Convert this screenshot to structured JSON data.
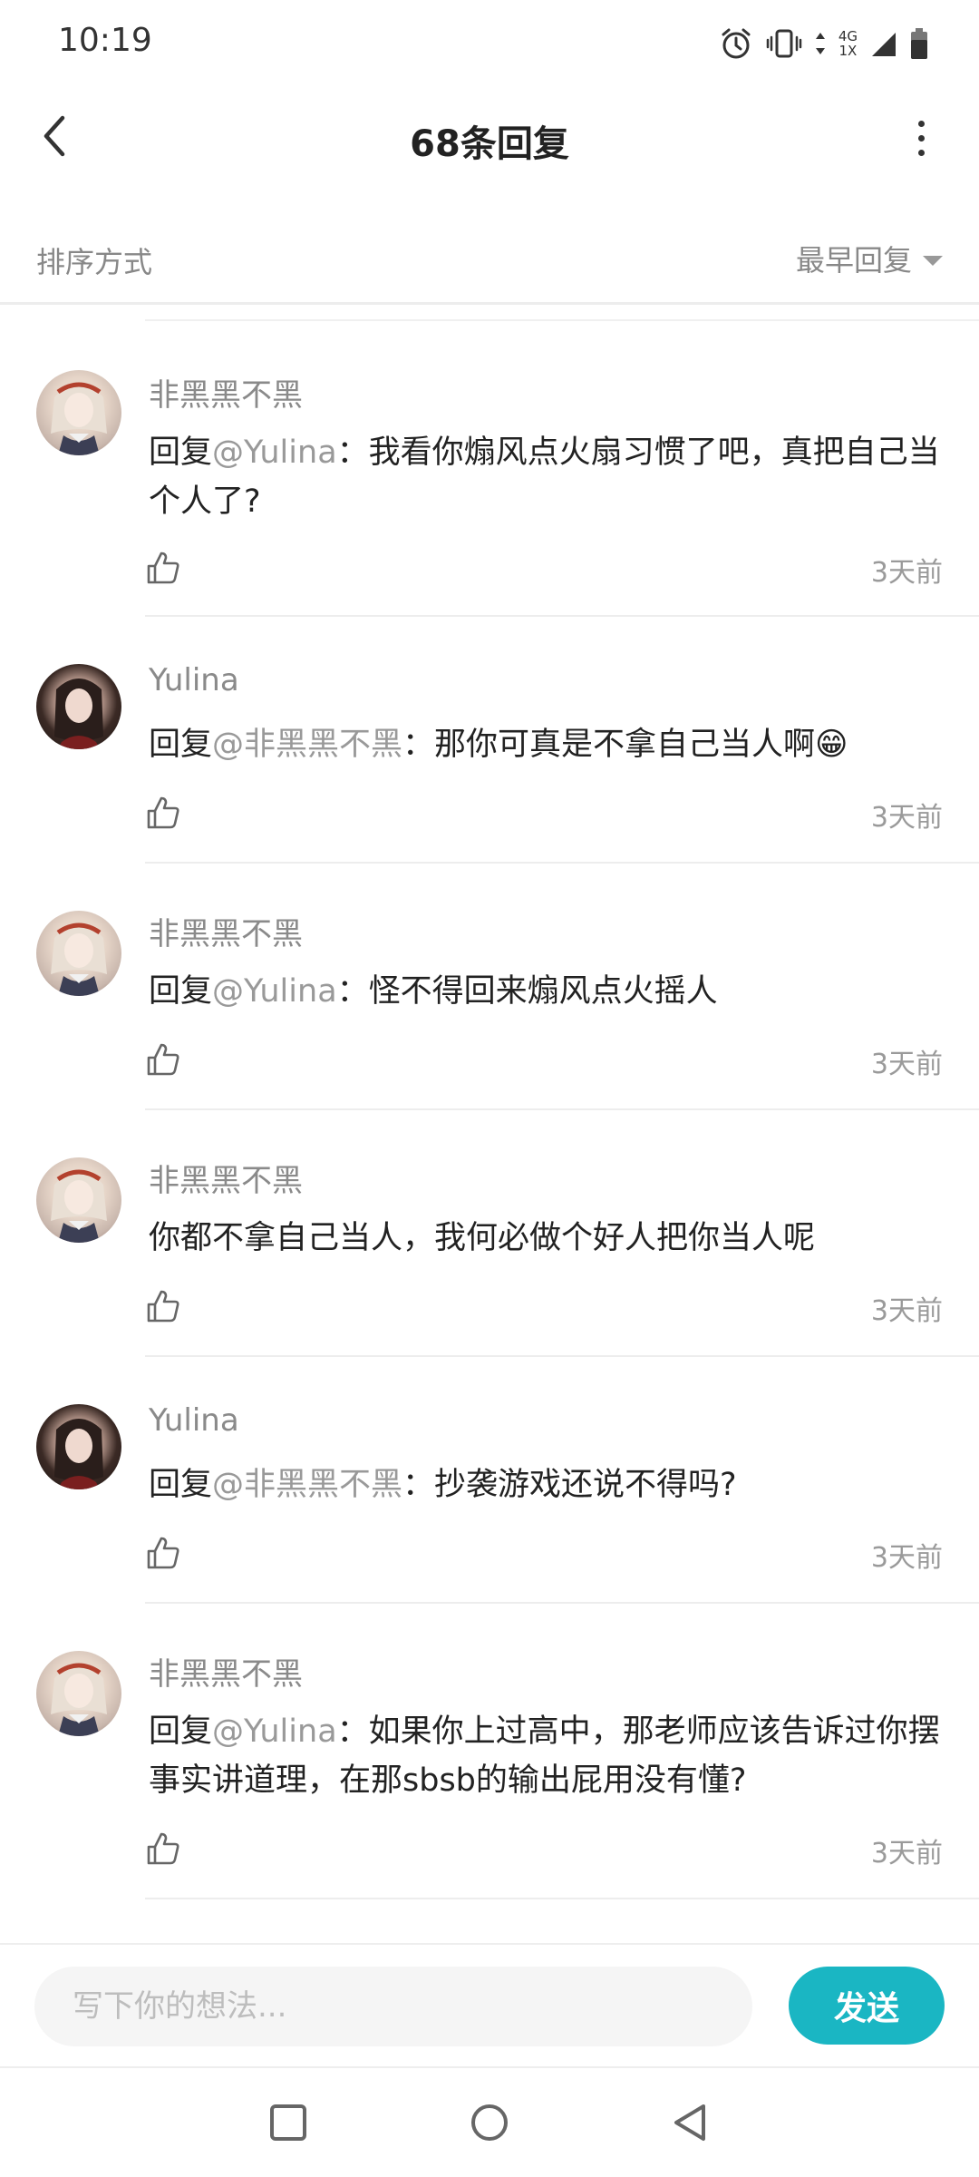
{
  "status_bar": {
    "time": "10:19",
    "network_top": "4G",
    "network_bottom": "1X",
    "icons": [
      "alarm-icon",
      "vibrate-icon",
      "data-arrows-icon",
      "signal-icon",
      "battery-icon"
    ]
  },
  "header": {
    "title": "68条回复",
    "back_icon": "chevron-left-icon",
    "more_icon": "more-vertical-icon"
  },
  "sort": {
    "label": "排序方式",
    "selected": "最早回复"
  },
  "comments": [
    {
      "author": "非黑黑不黑",
      "prefix": "回复",
      "mention": "@Yulina",
      "body": "：我看你煽风点火扇习惯了吧，真把自己当个人了?",
      "time": "3天前",
      "avatar": "anime-avatar"
    },
    {
      "author": "Yulina",
      "prefix": "回复",
      "mention": "@非黑黑不黑",
      "body": "：那你可真是不拿自己当人啊😁",
      "time": "3天前",
      "avatar": "girl-avatar"
    },
    {
      "author": "非黑黑不黑",
      "prefix": "回复",
      "mention": "@Yulina",
      "body": "：怪不得回来煽风点火摇人",
      "time": "3天前",
      "avatar": "anime-avatar"
    },
    {
      "author": "非黑黑不黑",
      "prefix": "",
      "mention": "",
      "body": "你都不拿自己当人，我何必做个好人把你当人呢",
      "time": "3天前",
      "avatar": "anime-avatar"
    },
    {
      "author": "Yulina",
      "prefix": "回复",
      "mention": "@非黑黑不黑",
      "body": "：抄袭游戏还说不得吗?",
      "time": "3天前",
      "avatar": "girl-avatar"
    },
    {
      "author": "非黑黑不黑",
      "prefix": "回复",
      "mention": "@Yulina",
      "body": "：如果你上过高中，那老师应该告诉过你摆事实讲道理，在那sbsb的输出屁用没有懂?",
      "time": "3天前",
      "avatar": "anime-avatar"
    }
  ],
  "input": {
    "placeholder": "写下你的想法...",
    "value": ""
  },
  "send_label": "发送",
  "nav": [
    "square-icon",
    "circle-icon",
    "triangle-back-icon"
  ],
  "colors": {
    "accent": "#1ab6c3",
    "mention": "#999999",
    "muted": "#888888"
  }
}
